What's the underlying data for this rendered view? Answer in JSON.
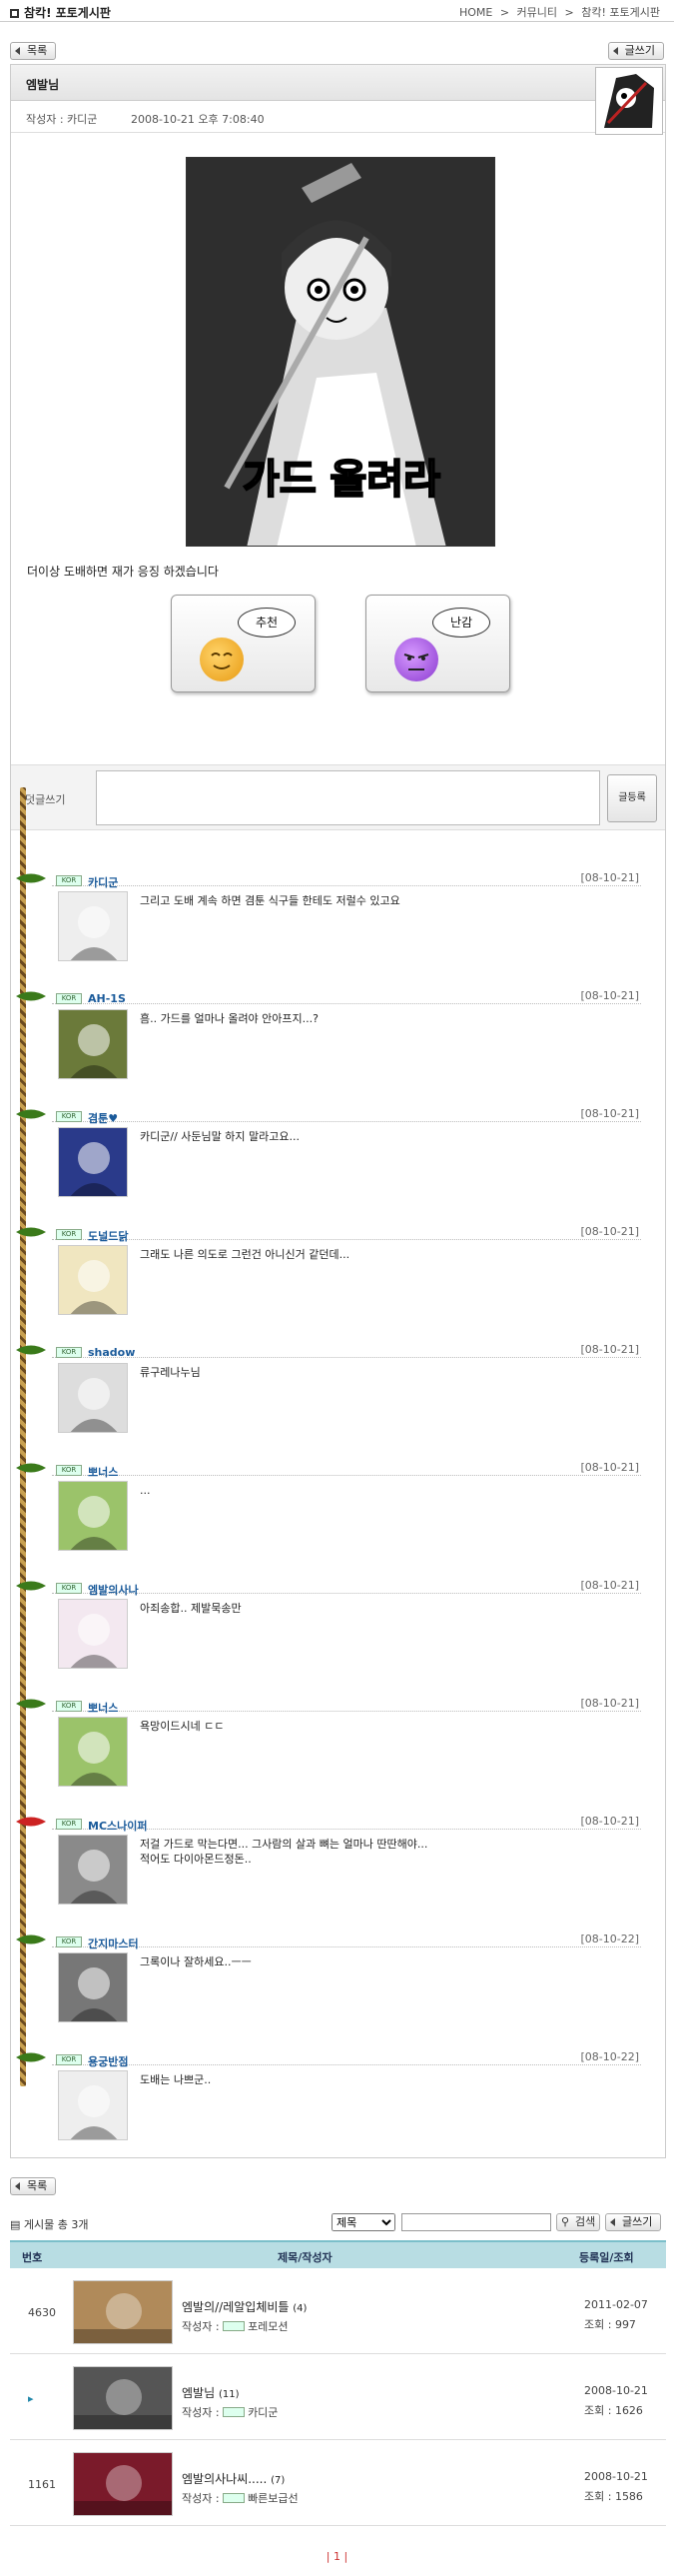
{
  "header": {
    "title": "참칵! 포토게시판",
    "breadcrumb": [
      "HOME",
      ">",
      "커뮤니티",
      ">",
      "참칵! 포토게시판"
    ]
  },
  "buttons": {
    "list": "목록",
    "write": "글쓰기",
    "comment_submit": "글등록",
    "search": "검색"
  },
  "post": {
    "subject": "엠발님",
    "author": "작성자 : 카디군",
    "date": "2008-10-21 오후 7:08:40",
    "image_text": "가드 올려라",
    "body": "더이상 도배하면 재가 응징 하겠습니다",
    "vote_recommend": "추천",
    "vote_hard": "난감"
  },
  "comment_form": {
    "label": "덧글쓰기"
  },
  "comments": [
    {
      "nick": "카디군",
      "date": "[08-10-21]",
      "text": "그리고 도배 계속 하면 겸툰 식구들 한테도 저럴수 있고요",
      "lvl": "KOR"
    },
    {
      "nick": "AH-1S",
      "date": "[08-10-21]",
      "text": "흠.. 가드를 얼마나 올려야 안아프지...?",
      "lvl": "KOR"
    },
    {
      "nick": "겸툰♥",
      "date": "[08-10-21]",
      "text": "카디군// 사둔님말 하지 말라고요...",
      "lvl": "KOR"
    },
    {
      "nick": "도널드닭",
      "date": "[08-10-21]",
      "text": "그래도 나른 의도로 그런건 아니신거 같던데...",
      "lvl": "KOR"
    },
    {
      "nick": "shadow",
      "date": "[08-10-21]",
      "text": "류구레나누님",
      "lvl": "KOR"
    },
    {
      "nick": "뽀너스",
      "date": "[08-10-21]",
      "text": "...",
      "lvl": "KOR"
    },
    {
      "nick": "엠발의사나",
      "date": "[08-10-21]",
      "text": "아죄송합.. 제발묵송만",
      "lvl": "KOR"
    },
    {
      "nick": "뽀너스",
      "date": "[08-10-21]",
      "text": "욕망이드시네 ㄷㄷ",
      "lvl": "KOR"
    },
    {
      "nick": "MC스나이퍼",
      "date": "[08-10-21]",
      "text": "저걸 가드로 막는다면... 그사람의 살과 뼈는 얼마나 딴딴해야...\n적어도 다이아몬드정돈..",
      "lvl": "KOR"
    },
    {
      "nick": "간지마스터",
      "date": "[08-10-22]",
      "text": "그록이나 잘하세요..ㅡㅡ",
      "lvl": "KOR"
    },
    {
      "nick": "용궁반점",
      "date": "[08-10-22]",
      "text": "도배는 나쁘군..",
      "lvl": "KOR"
    }
  ],
  "list": {
    "total": "게시물 총 3개",
    "search_option": "제목",
    "headers": {
      "num": "번호",
      "title": "제목/작성자",
      "date": "등록일/조회"
    },
    "rows": [
      {
        "num": "4630",
        "title": "엠발의//레알입체비틀 ",
        "cmt": "(4)",
        "author": "작성자 : ",
        "nick": "포레모션",
        "date": "2011-02-07",
        "views": "조회 : 997"
      },
      {
        "num": "",
        "title": "엠발님 ",
        "cmt": "(11)",
        "author": "작성자 : ",
        "nick": "카디군",
        "date": "2008-10-21",
        "views": "조회 : 1626"
      },
      {
        "num": "1161",
        "title": "엠발의사나씨..... ",
        "cmt": "(7)",
        "author": "작성자 : ",
        "nick": "빠른보급선",
        "date": "2008-10-21",
        "views": "조회 : 1586"
      }
    ]
  },
  "pager": "| 1 |",
  "colors": {
    "header_bg": "#b8dde3",
    "nick": "#1a5a9a",
    "vine": "#c8a050"
  }
}
